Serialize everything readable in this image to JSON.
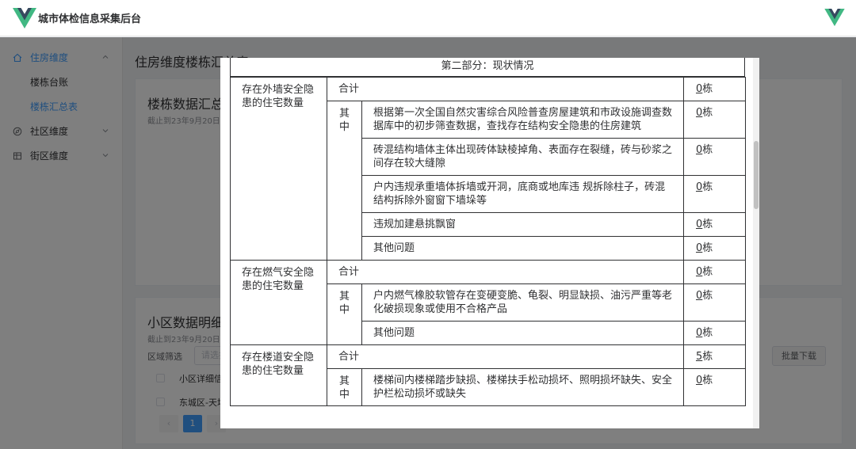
{
  "app": {
    "title": "城市体检信息采集后台"
  },
  "sidebar": {
    "groups": [
      {
        "label": "住房维度",
        "icon": "home-icon",
        "expanded": true,
        "children": [
          {
            "label": "楼栋台账"
          },
          {
            "label": "楼栋汇总表",
            "active": true
          }
        ]
      },
      {
        "label": "社区维度",
        "icon": "compass-icon"
      },
      {
        "label": "街区维度",
        "icon": "grid-icon"
      }
    ]
  },
  "main": {
    "title": "住房维度楼栋汇总表",
    "card1": {
      "title": "楼栋数据汇总",
      "subtitle": "截止到23年9月20日"
    },
    "card2": {
      "title": "小区数据明细",
      "subtitle": "截止到23年9月20日",
      "filter_label": "区域筛选",
      "filter_placeholder": "请选择",
      "batch_download": "批量下载",
      "rows": [
        "小区详细信息",
        "东城区-天坛"
      ],
      "page": "1",
      "prev": "‹",
      "next": "›"
    }
  },
  "dialog": {
    "section_title": "第二部分：现状情况",
    "sub_label": "其中",
    "categories": [
      {
        "label": "存在外墙安全隐患的住宅数量",
        "total_label": "合计",
        "total": "0",
        "items": [
          {
            "text": "根据第一次全国自然灾害综合风险普查房屋建筑和市政设施调查数据库中的初步筛查数据，查找存在结构安全隐患的住房建筑",
            "count": "0"
          },
          {
            "text": "砖混结构墙体主体出现砖体缺棱掉角、表面存在裂缝，砖与砂浆之间存在较大缝隙",
            "count": "0"
          },
          {
            "text": "户内违规承重墙体拆墙或开洞，底商或地库违 规拆除柱子，砖混结构拆除外窗窗下墙垛等",
            "count": "0"
          },
          {
            "text": "违规加建悬挑飘窗",
            "count": "0"
          },
          {
            "text": "其他问题",
            "count": "0"
          }
        ]
      },
      {
        "label": "存在燃气安全隐患的住宅数量",
        "total_label": "合计",
        "total": "0",
        "items": [
          {
            "text": "户内燃气橡胶软管存在变硬变脆、龟裂、明显缺损、油污严重等老化破损现象或使用不合格产品",
            "count": "0"
          },
          {
            "text": "其他问题",
            "count": "0"
          }
        ]
      },
      {
        "label": "存在楼道安全隐患的住宅数量",
        "total_label": "合计",
        "total": "5",
        "items": [
          {
            "text": "楼梯间内楼梯踏步缺损、楼梯扶手松动损坏、照明损坏缺失、安全护栏松动损坏或缺失",
            "count": "0"
          }
        ]
      }
    ],
    "unit": "栋"
  },
  "colors": {
    "accent": "#409eff",
    "overlay": "rgba(0,0,0,0.5)"
  }
}
